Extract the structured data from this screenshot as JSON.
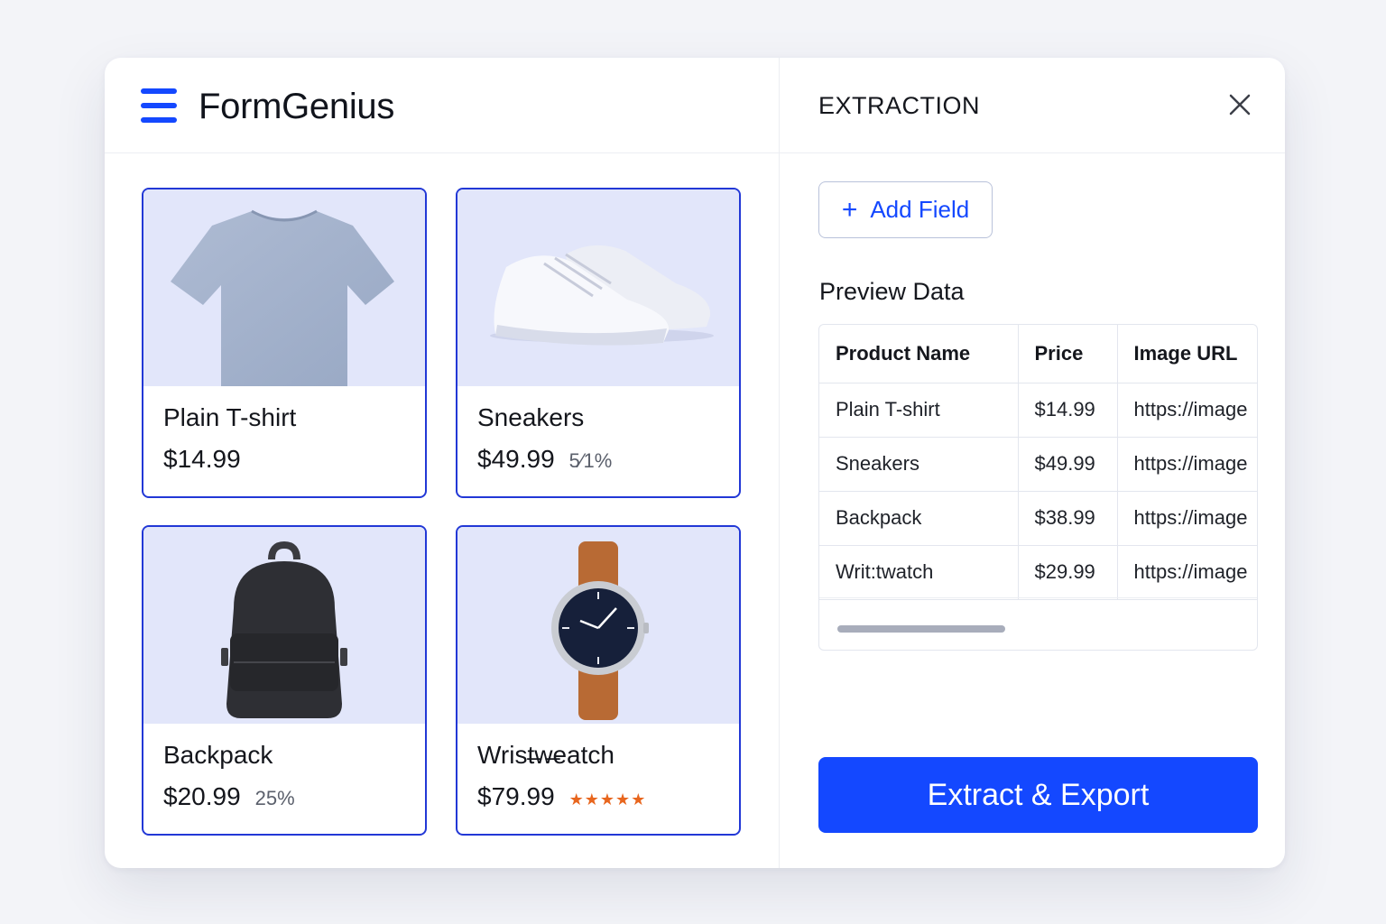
{
  "app": {
    "name": "FormGenius",
    "menu_icon": "hamburger-menu-icon",
    "accent": "#1448ff"
  },
  "products": [
    {
      "name": "Plain T-shirt",
      "price": "$14.99",
      "badge": "",
      "stars": "",
      "image": "tshirt"
    },
    {
      "name": "Sneakers",
      "price": "$49.99",
      "badge": "5⁄1%",
      "stars": "",
      "image": "sneakers"
    },
    {
      "name": "Backpack",
      "price": "$20.99",
      "badge": "25%",
      "stars": "",
      "image": "backpack"
    },
    {
      "name": "Wrist̶w̶eatch",
      "price": "$79.99",
      "badge": "",
      "stars": "★★★★★",
      "image": "wristwatch"
    }
  ],
  "extraction": {
    "title": "EXTRACTION",
    "close_icon": "close-icon",
    "add_field_label": "Add Field",
    "add_icon": "plus-icon",
    "preview_title": "Preview Data",
    "table": {
      "columns": [
        "Product Name",
        "Price",
        "Image URL"
      ],
      "rows": [
        [
          "Plain T-shirt",
          "$14.99",
          "https://image"
        ],
        [
          "Sneakers",
          "$49.99",
          "https://image"
        ],
        [
          "Backpack",
          "$38.99",
          "https://image"
        ],
        [
          "Writ:twatch",
          "$29.99",
          "https://image"
        ]
      ]
    },
    "export_label": "Extract & Export"
  },
  "colors": {
    "card_border": "#2238d6",
    "image_bg": "#e2e6fa",
    "star": "#e8661e",
    "primary_button": "#1448ff"
  }
}
